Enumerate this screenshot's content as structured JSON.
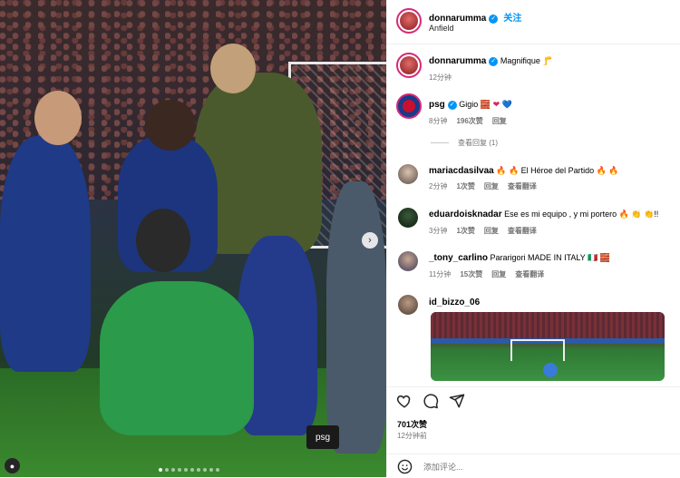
{
  "post": {
    "author": "donnarumma",
    "follow_label": "关注",
    "location": "Anfield",
    "image_tag": "psg"
  },
  "caption": {
    "username": "donnarumma",
    "text": "Magnifique",
    "emoji": "🦵",
    "time": "12分钟"
  },
  "comments": [
    {
      "username": "psg",
      "verified": true,
      "text": "Gigio",
      "emoji": [
        "🧱",
        "❤",
        "💙"
      ],
      "time": "8分钟",
      "likes": "196次赞",
      "reply_label": "回复",
      "view_replies": "查看回复 (1)"
    },
    {
      "username": "mariacdasilvaa",
      "verified": false,
      "text": "🔥 🔥 El Héroe del Partido 🔥 🔥",
      "time": "2分钟",
      "likes": "1次赞",
      "reply_label": "回复",
      "translate_label": "查看翻译"
    },
    {
      "username": "eduardoisknadar",
      "verified": false,
      "text": "Ese es mi equipo , y mi portero 🔥 👏 👏!!",
      "time": "3分钟",
      "likes": "1次赞",
      "reply_label": "回复",
      "translate_label": "查看翻译"
    },
    {
      "username": "_tony_carlino",
      "verified": false,
      "text": "Pararigori MADE IN ITALY 🇮🇹 🧱",
      "time": "11分钟",
      "likes": "15次赞",
      "reply_label": "回复",
      "translate_label": "查看翻译"
    },
    {
      "username": "id_bizzo_06",
      "verified": false,
      "text": ""
    }
  ],
  "actions": {
    "like_icon": "heart-icon",
    "comment_icon": "comment-icon",
    "share_icon": "send-icon",
    "likes_count": "701次赞",
    "posted_ago": "12分钟前"
  },
  "add_comment": {
    "placeholder": "添加评论..."
  },
  "colors": {
    "accent": "#0095f6",
    "muted": "#737373",
    "ring": "#d62976",
    "psg_navy": "#1a3a8a"
  }
}
